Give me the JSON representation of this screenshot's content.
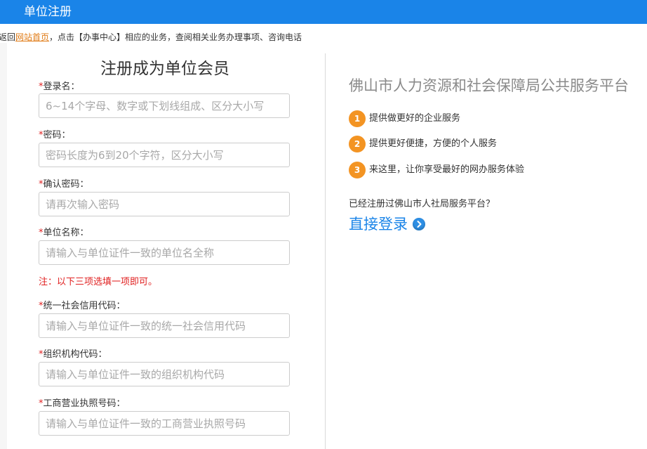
{
  "header": {
    "title": "单位注册"
  },
  "notice": {
    "prefix": "返回",
    "home_link": "网站首页",
    "suffix": "，点击【办事中心】相应的业务，查阅相关业务办理事项、咨询电话"
  },
  "form": {
    "title": "注册成为单位会员",
    "required_mark": "*",
    "fields": [
      {
        "label": "登录名：",
        "placeholder": "6~14个字母、数字或下划线组成、区分大小写",
        "value": ""
      },
      {
        "label": "密码：",
        "placeholder": "密码长度为6到20个字符，区分大小写",
        "value": ""
      },
      {
        "label": "确认密码：",
        "placeholder": "请再次输入密码",
        "value": ""
      },
      {
        "label": "单位名称：",
        "placeholder": "请输入与单位证件一致的单位名全称",
        "value": ""
      },
      {
        "label": "统一社会信用代码：",
        "placeholder": "请输入与单位证件一致的统一社会信用代码",
        "value": ""
      },
      {
        "label": "组织机构代码：",
        "placeholder": "请输入与单位证件一致的组织机构代码",
        "value": ""
      },
      {
        "label": "工商营业执照号码：",
        "placeholder": "请输入与单位证件一致的工商营业执照号码",
        "value": ""
      }
    ],
    "note": "注：以下三项选填一项即可。"
  },
  "side": {
    "title": "佛山市人力资源和社会保障局公共服务平台",
    "features": [
      {
        "num": "1",
        "text": "提供做更好的企业服务"
      },
      {
        "num": "2",
        "text": "提供更好便捷，方便的个人服务"
      },
      {
        "num": "3",
        "text": "来这里，让你享受最好的网办服务体验"
      }
    ],
    "question": "已经注册过佛山市人社局服务平台？",
    "login_label": "直接登录"
  },
  "colors": {
    "header_bg": "#1a84e8",
    "required": "#e02020",
    "badge": "#f39423",
    "link": "#1a84e8",
    "home_link": "#e07b16"
  },
  "icons": {
    "login": "chevron-right-circle-icon"
  }
}
